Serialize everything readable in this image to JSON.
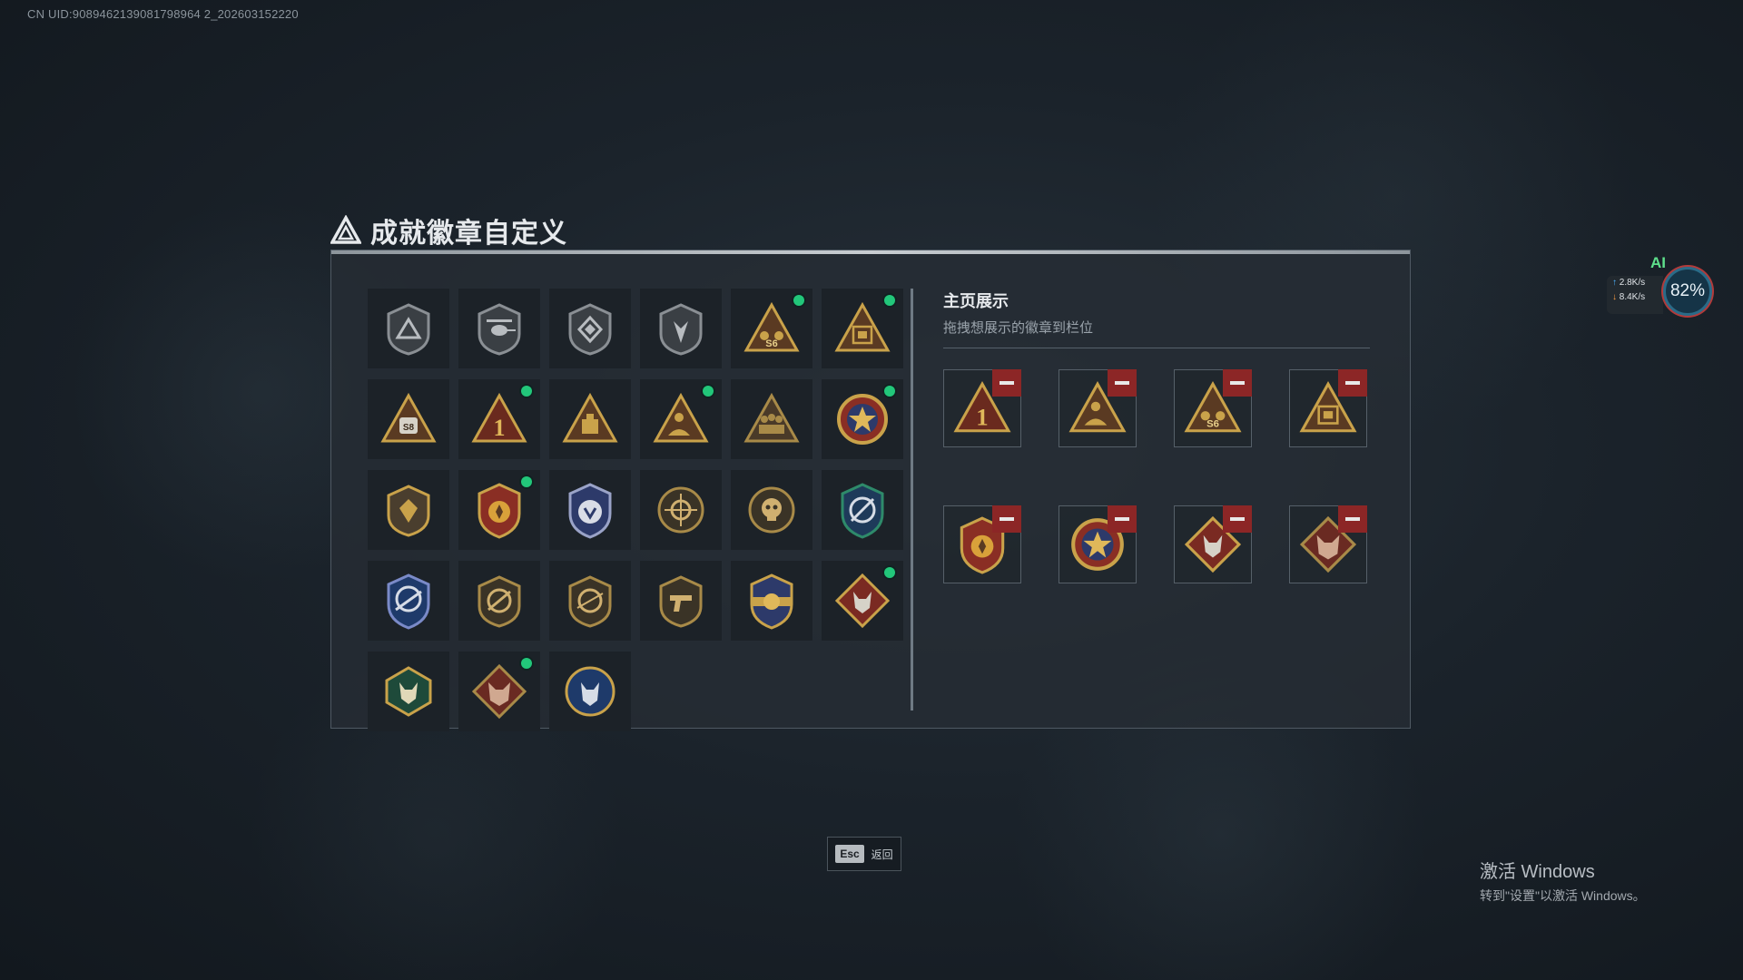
{
  "uid_text": "CN UID:9089462139081798964 2_202603152220",
  "title": "成就徽章自定义",
  "showcase": {
    "title": "主页展示",
    "subtitle": "拖拽想展示的徽章到栏位"
  },
  "badges": [
    {
      "name": "triangle-shield-badge",
      "new": false
    },
    {
      "name": "helicopter-shield-badge",
      "new": false
    },
    {
      "name": "diamond-shield-badge",
      "new": false
    },
    {
      "name": "arrow-shield-badge",
      "new": false
    },
    {
      "name": "s6-triangle-badge",
      "new": true
    },
    {
      "name": "gift-triangle-badge",
      "new": true
    },
    {
      "name": "s8-triangle-badge",
      "new": false
    },
    {
      "name": "number-one-triangle-badge",
      "new": true
    },
    {
      "name": "vault-triangle-badge",
      "new": false
    },
    {
      "name": "operator-triangle-badge",
      "new": true
    },
    {
      "name": "squad-triangle-badge",
      "new": false
    },
    {
      "name": "star-medal-badge",
      "new": true
    },
    {
      "name": "emblem-shield-badge",
      "new": false
    },
    {
      "name": "eagle-medal-badge",
      "new": true
    },
    {
      "name": "blue-crest-badge",
      "new": false
    },
    {
      "name": "crosshair-round-badge",
      "new": false
    },
    {
      "name": "skull-round-badge",
      "new": false
    },
    {
      "name": "blue-target-shield-badge",
      "new": false
    },
    {
      "name": "blue-rifle-shield-badge",
      "new": false
    },
    {
      "name": "rifle-shield-badge",
      "new": false
    },
    {
      "name": "sniper-shield-badge",
      "new": false
    },
    {
      "name": "pistol-shield-badge",
      "new": false
    },
    {
      "name": "gold-wings-badge",
      "new": false
    },
    {
      "name": "wolf-diamond-badge",
      "new": true
    },
    {
      "name": "green-wolf-badge",
      "new": false
    },
    {
      "name": "red-wolf-badge",
      "new": true
    },
    {
      "name": "blue-wolf-badge",
      "new": false
    }
  ],
  "showcase_slots": [
    {
      "name": "number-one-triangle-badge"
    },
    {
      "name": "operator-triangle-badge"
    },
    {
      "name": "s6-triangle-badge"
    },
    {
      "name": "gift-triangle-badge"
    },
    {
      "name": "eagle-medal-badge"
    },
    {
      "name": "star-medal-badge"
    },
    {
      "name": "wolf-diamond-badge"
    },
    {
      "name": "red-wolf-badge"
    }
  ],
  "esc": {
    "key": "Esc",
    "label": "返回"
  },
  "windows_activation": {
    "title": "激活 Windows",
    "subtitle": "转到\"设置\"以激活 Windows。"
  },
  "net_widget": {
    "ai": "AI",
    "upload": "2.8K/s",
    "download": "8.4K/s",
    "cpu": "82%"
  },
  "colors": {
    "accent_gold": "#c9a24a",
    "new_dot": "#22c77a",
    "remove_red": "#8c2626"
  }
}
